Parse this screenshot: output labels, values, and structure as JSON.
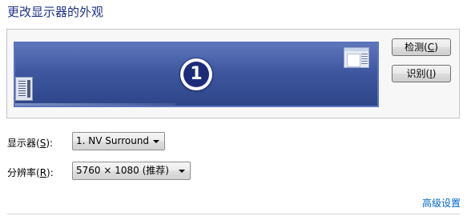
{
  "page": {
    "title": "更改显示器的外观"
  },
  "preview": {
    "monitor_number": "1"
  },
  "buttons": {
    "detect_label_prefix": "检测(",
    "detect_hotkey": "C",
    "detect_label_suffix": ")",
    "identify_label_prefix": "识别(",
    "identify_hotkey": "I",
    "identify_label_suffix": ")"
  },
  "display": {
    "label_prefix": "显示器(",
    "label_hotkey": "S",
    "label_suffix": "):",
    "selected": "1. NV Surround"
  },
  "resolution": {
    "label_prefix": "分辨率(",
    "label_hotkey": "R",
    "label_suffix": "):",
    "selected": "5760 × 1080 (推荐)"
  },
  "advanced": {
    "link_label": "高级设置"
  },
  "colors": {
    "title": "#1e3287",
    "link": "#0066cc",
    "monitor_fill": "#3e579f"
  }
}
